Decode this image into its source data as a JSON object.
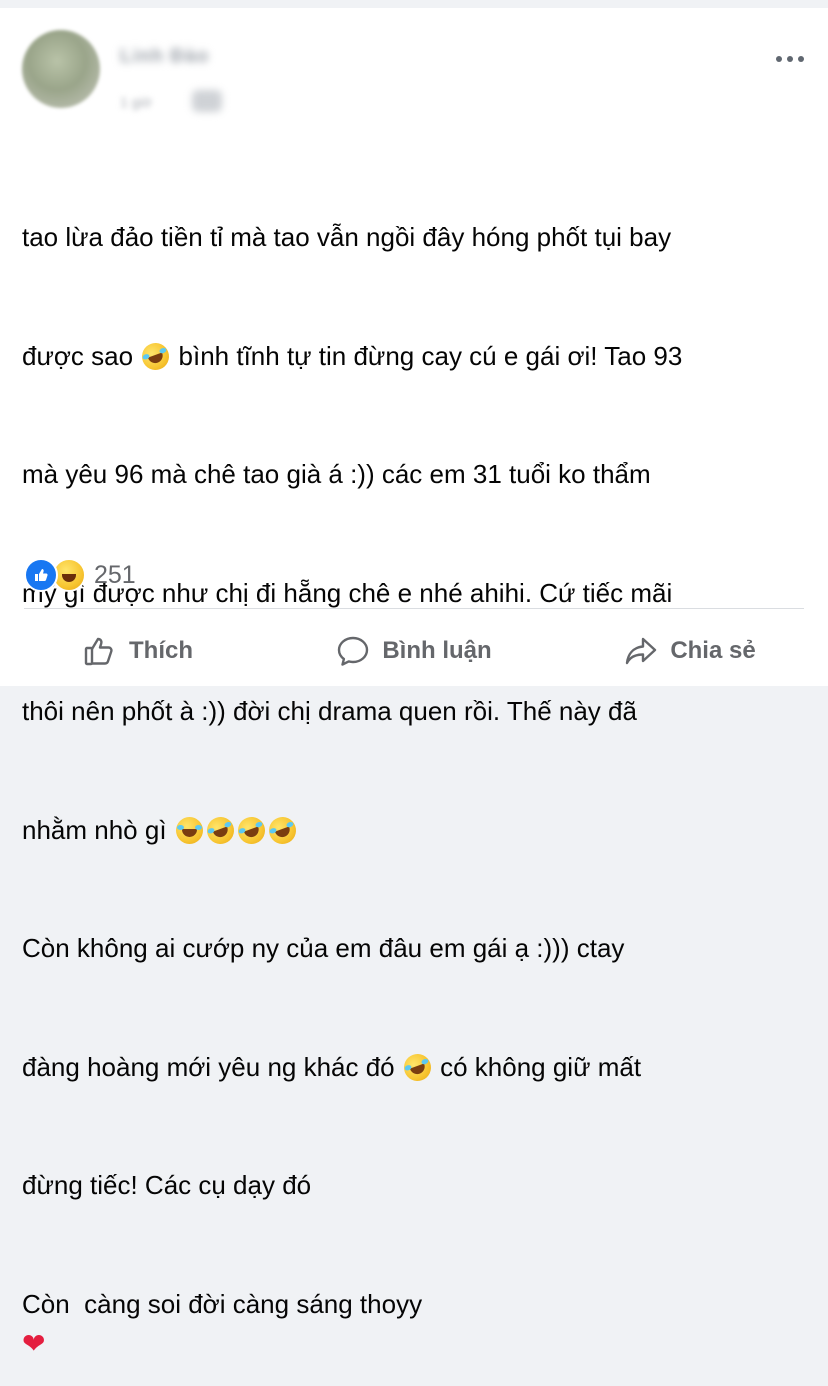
{
  "post": {
    "author_name": "Linh Đào",
    "timestamp": "1 giờ",
    "lines": [
      {
        "before": "tao lừa đảo tiền tỉ mà tao vẫn ngồi đây hóng phốt tụi bay",
        "after": ""
      },
      {
        "before": "được sao ",
        "after": " bình tĩnh tự tin đừng cay cú e gái ơi! Tao 93"
      },
      {
        "before": "mà yêu 96 mà chê tao già á :)) các em 31 tuổi ko thẩm",
        "after": ""
      },
      {
        "before": "mỹ gì được như chị đi hẵng chê e nhé ahihi. Cứ tiếc mãi",
        "after": ""
      },
      {
        "before": "thôi nên phốt à :)) đời chị drama quen rồi. Thế này đã",
        "after": ""
      },
      {
        "before": "nhằm nhò gì ",
        "after": ""
      },
      {
        "before": "Còn không ai cướp ny của em đâu em gái ạ :))) ctay",
        "after": ""
      },
      {
        "before": "đàng hoàng mới yêu ng khác đó ",
        "after": " có không giữ mất"
      },
      {
        "before": "đừng tiếc! Các cụ dạy đó",
        "after": ""
      },
      {
        "before": "Còn  càng soi đời càng sáng thoyy",
        "after": ""
      }
    ],
    "heart": "❤"
  },
  "reactions": {
    "count": "251",
    "types": [
      "like-icon",
      "haha-icon"
    ]
  },
  "actions": {
    "like_label": "Thích",
    "comment_label": "Bình luận",
    "share_label": "Chia sẻ"
  },
  "colors": {
    "like_blue": "#1877f2",
    "text_primary": "#050505",
    "text_secondary": "#65676b",
    "heart_red": "#e41e3f"
  }
}
